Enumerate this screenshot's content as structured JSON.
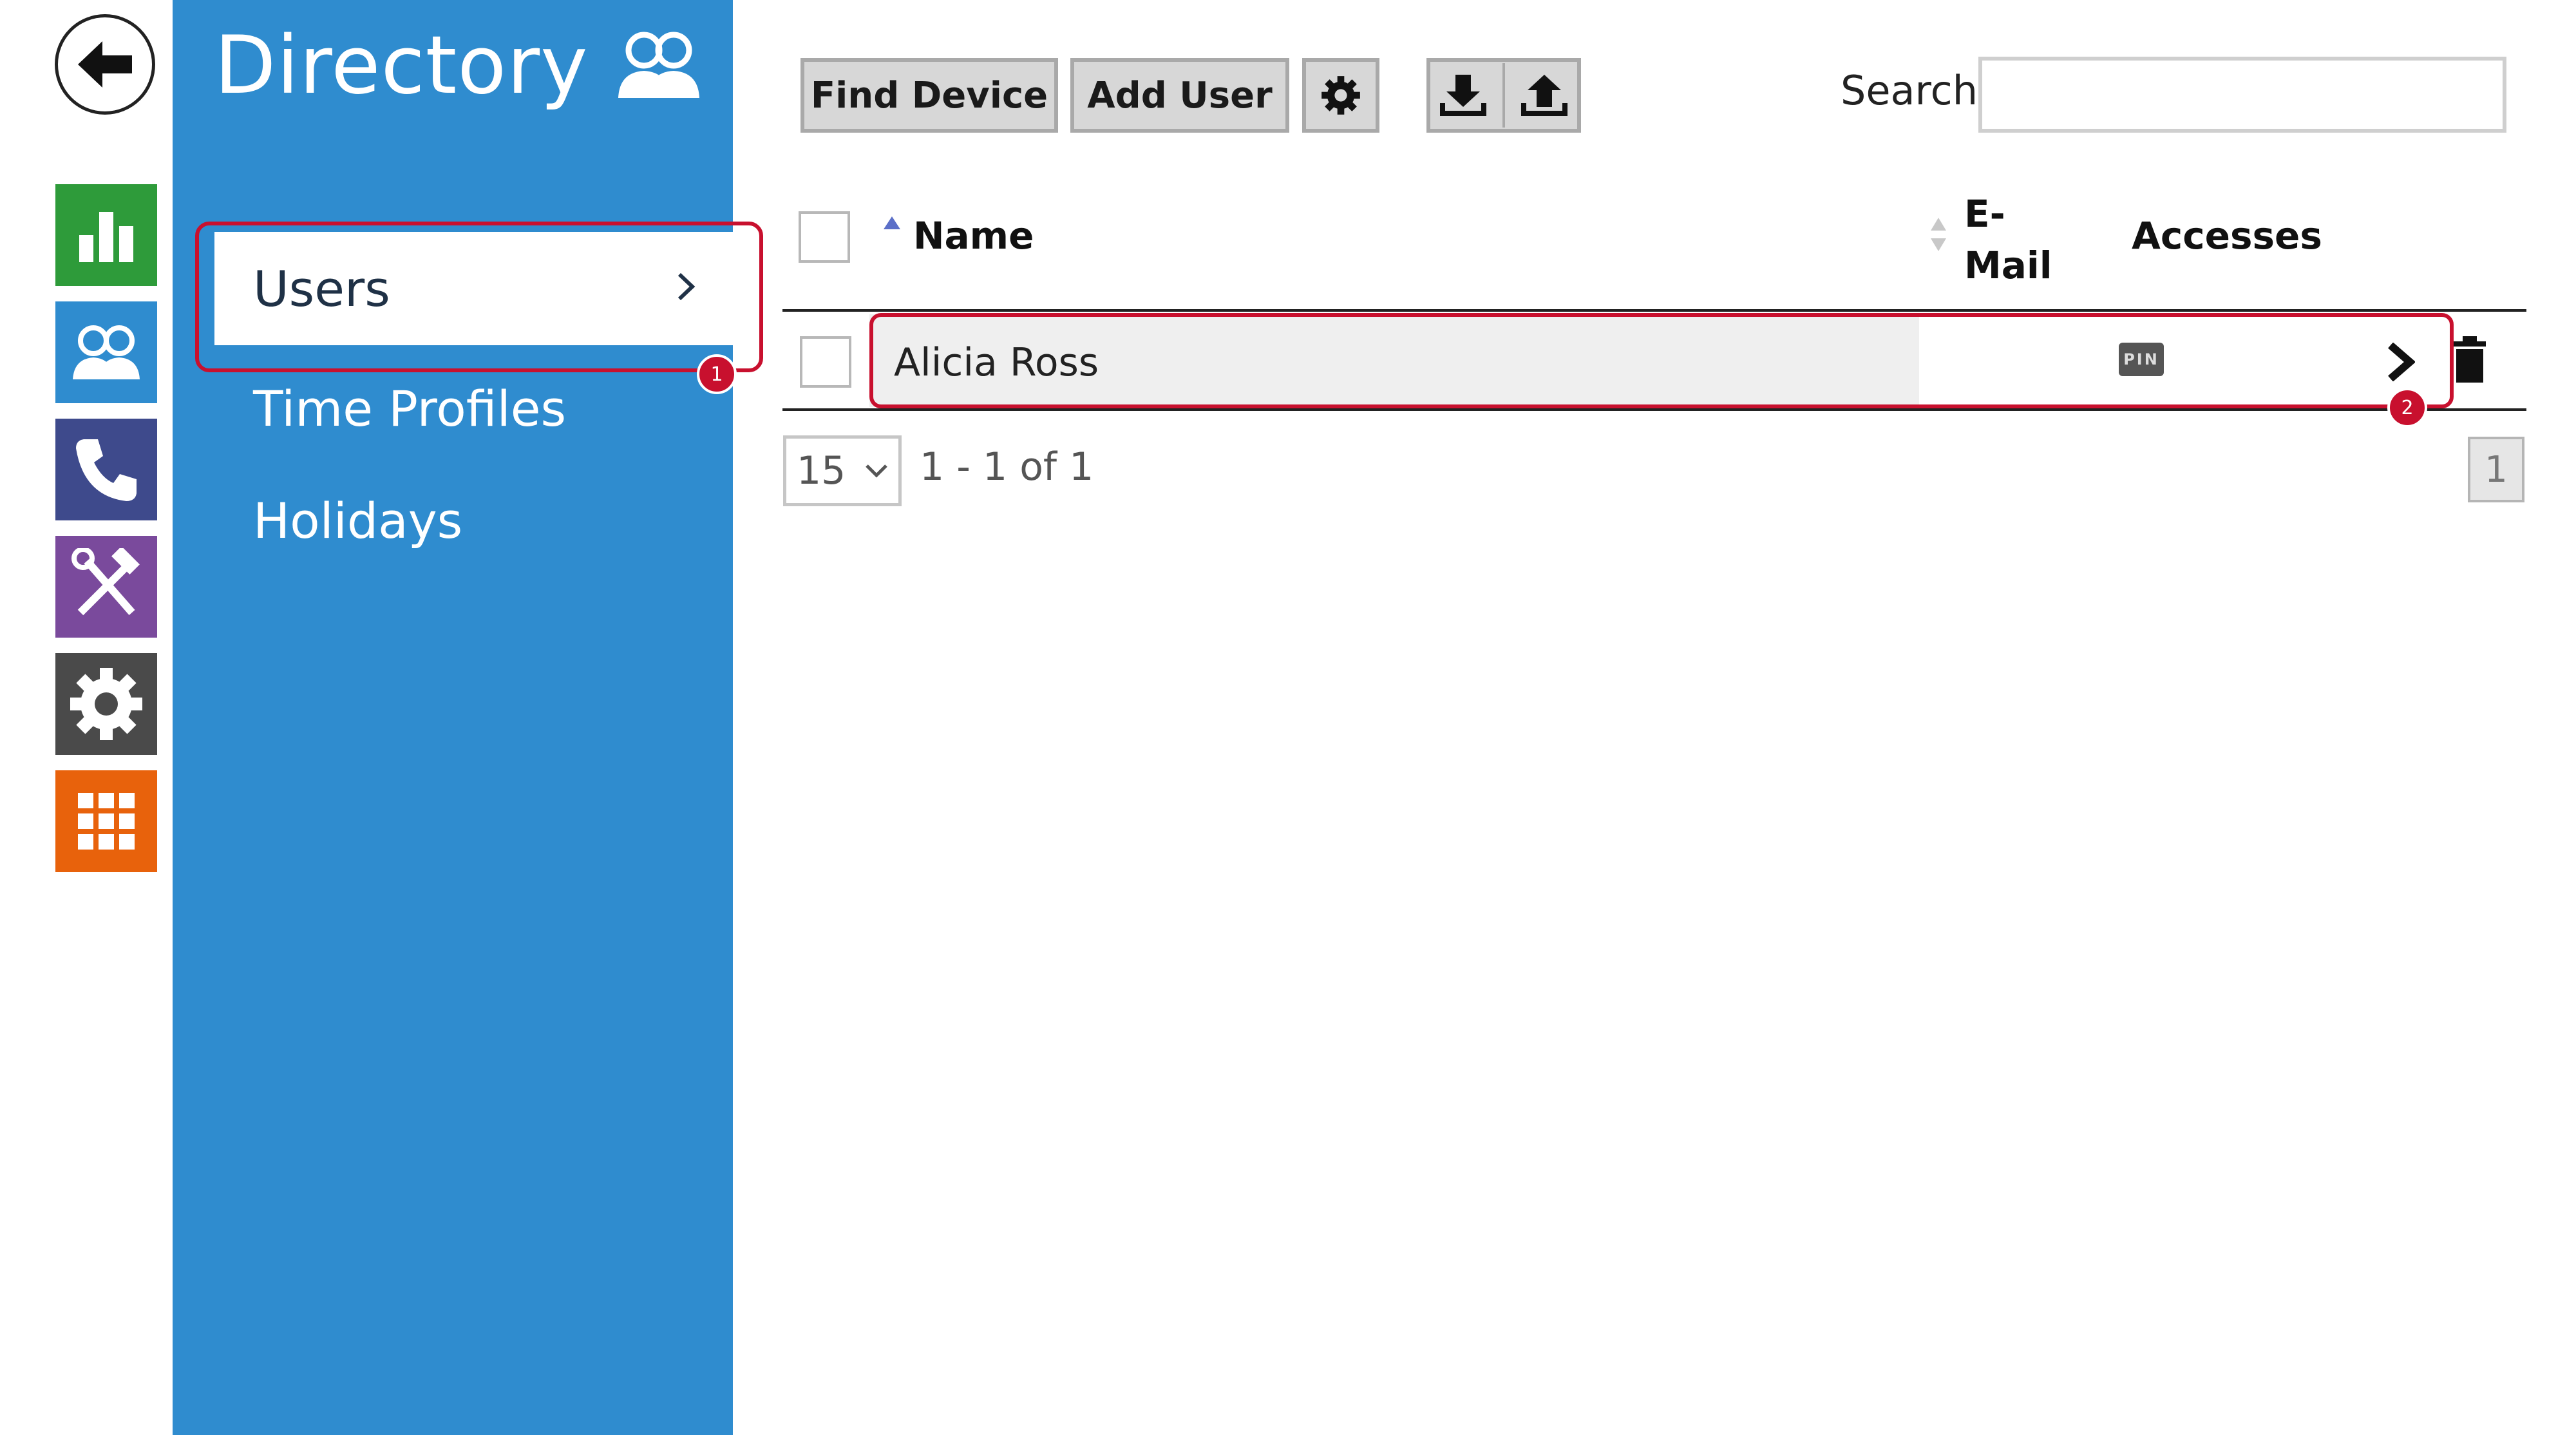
{
  "rail": {
    "back": "back-arrow-icon",
    "tiles": [
      {
        "name": "status",
        "icon": "bar-chart-icon",
        "color": "#2e9b3a"
      },
      {
        "name": "directory",
        "icon": "users-icon",
        "color": "#2f8ccf"
      },
      {
        "name": "calls",
        "icon": "phone-icon",
        "color": "#3e4a8c"
      },
      {
        "name": "hardware",
        "icon": "tools-icon",
        "color": "#7a4a9c"
      },
      {
        "name": "system",
        "icon": "gear-icon",
        "color": "#4a4a4a"
      },
      {
        "name": "services",
        "icon": "grid-icon",
        "color": "#e8620c"
      }
    ]
  },
  "sidebar": {
    "title": "Directory",
    "title_icon": "users-icon",
    "items": [
      {
        "label": "Users",
        "active": true
      },
      {
        "label": "Time Profiles"
      },
      {
        "label": "Holidays"
      }
    ],
    "marker": "1"
  },
  "toolbar": {
    "find_device": "Find Device",
    "add_user": "Add User",
    "settings_icon": "gear-icon",
    "download_icon": "download-icon",
    "upload_icon": "upload-icon",
    "search_label": "Search",
    "search_value": ""
  },
  "table": {
    "columns": [
      "Name",
      "E-Mail",
      "Accesses"
    ],
    "email_line1": "E-",
    "email_line2": "Mail",
    "rows": [
      {
        "name": "Alicia Ross",
        "email": "",
        "access_badge": "PIN"
      }
    ],
    "row_marker": "2"
  },
  "pagination": {
    "page_size": "15",
    "range": "1 - 1 of 1",
    "current_page": "1"
  },
  "colors": {
    "sidebar": "#2f8ccf",
    "highlight": "#c8102e"
  }
}
